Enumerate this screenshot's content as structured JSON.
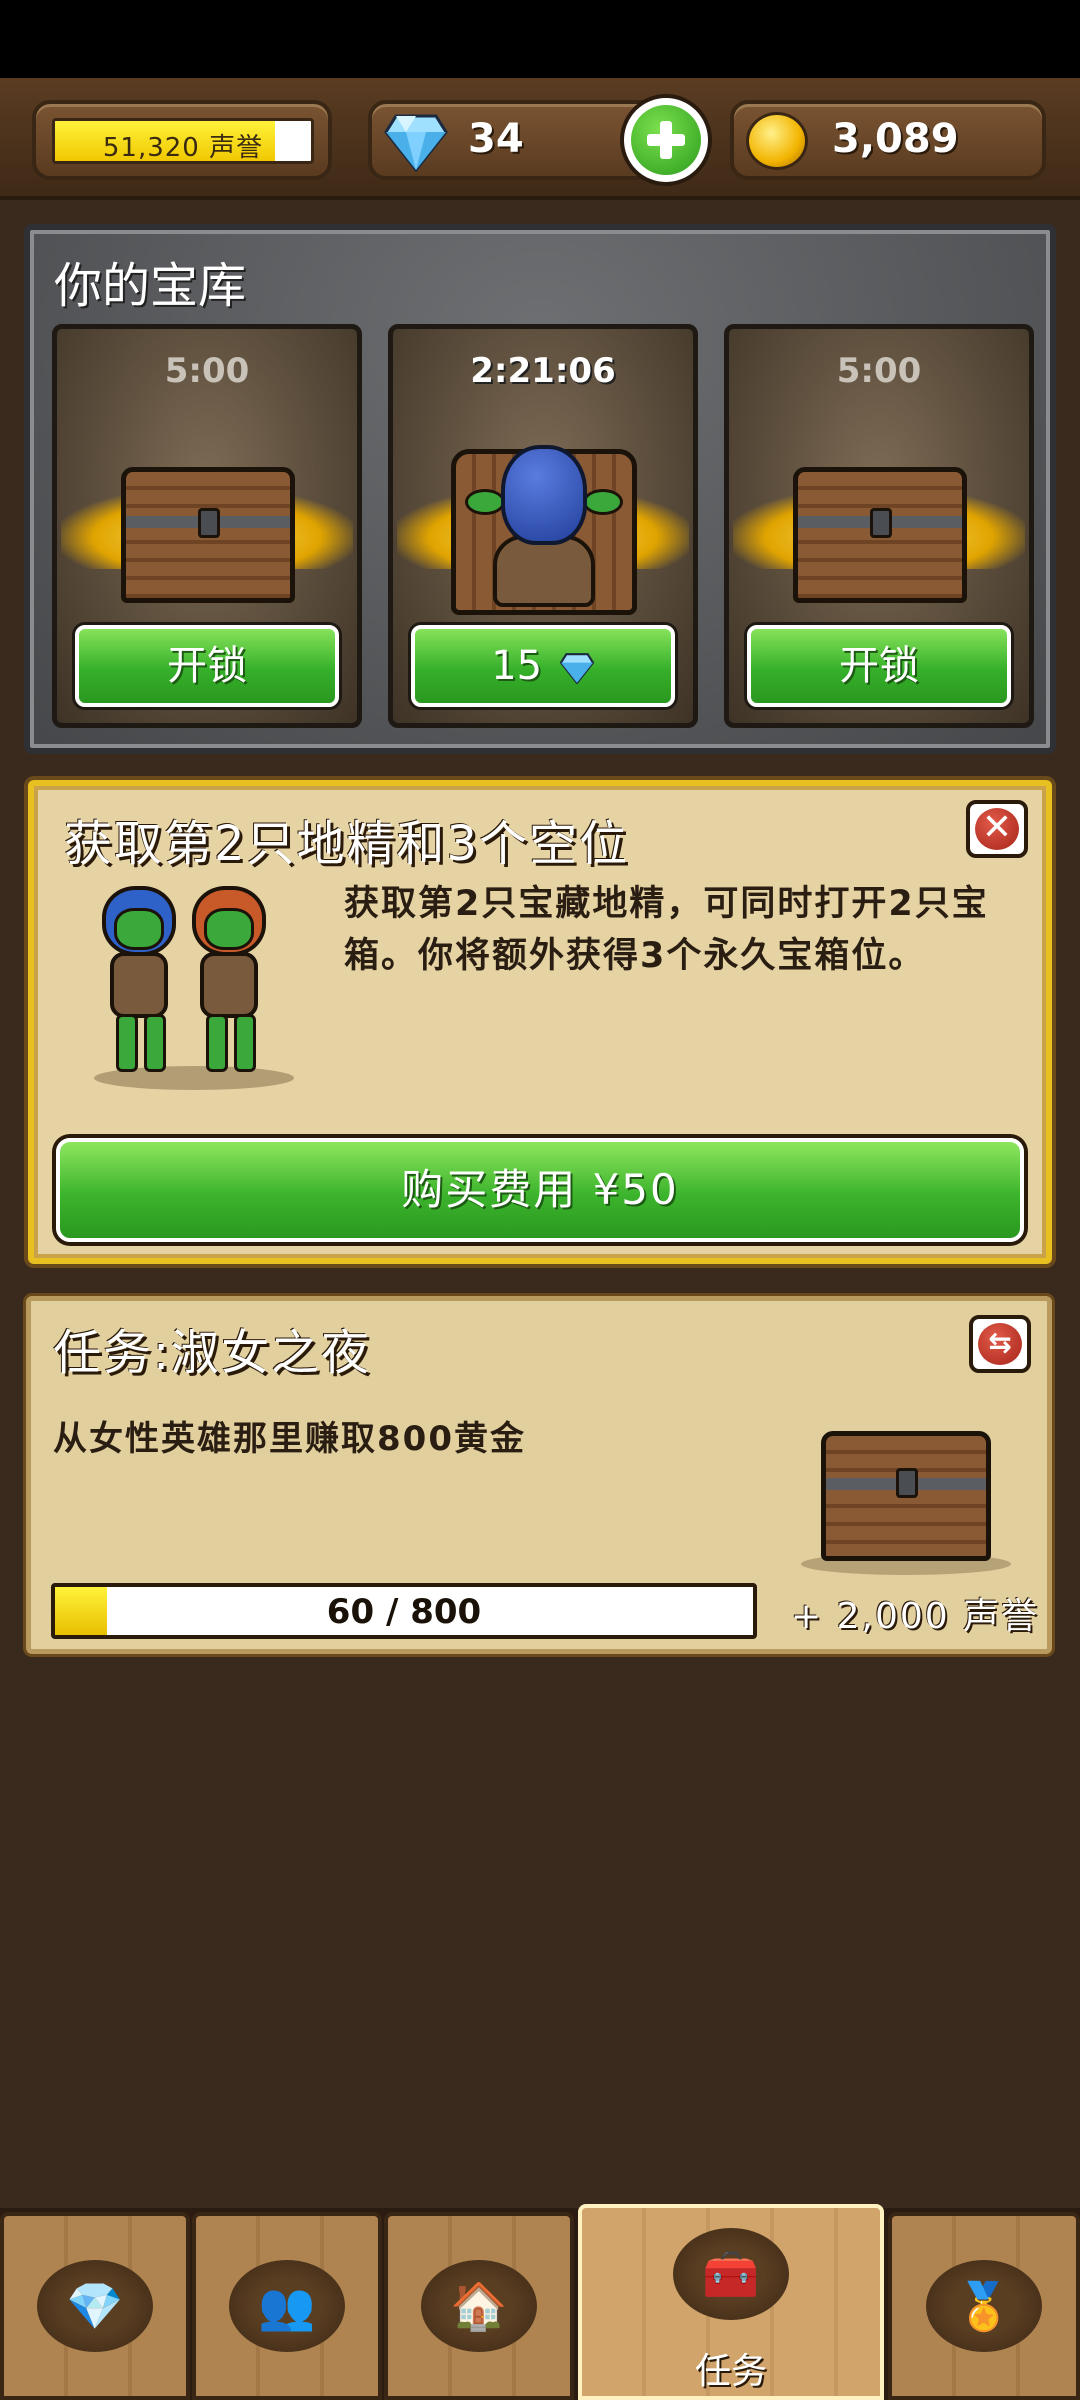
{
  "header": {
    "reputation": "51,320 声誉",
    "reputation_fill": 0.86,
    "gems": "34",
    "coins": "3,089"
  },
  "vault": {
    "title": "你的宝库",
    "slots": [
      {
        "timer": "5:00",
        "button": "开锁"
      },
      {
        "timer": "2:21:06",
        "button": "15"
      },
      {
        "timer": "5:00",
        "button": "开锁"
      }
    ]
  },
  "offer": {
    "title": "获取第2只地精和3个空位",
    "description": "获取第2只宝藏地精，可同时打开2只宝箱。你将额外获得3个永久宝箱位。",
    "buy_label": "购买费用 ¥50"
  },
  "quest": {
    "title": "任务:淑女之夜",
    "description": "从女性英雄那里赚取800黄金",
    "progress_text": "60 / 800",
    "progress_value": 60,
    "progress_max": 800,
    "reward": "+ 2,000 声誉"
  },
  "nav": {
    "items": [
      {
        "icon": "gem-icon",
        "glyph": "💎"
      },
      {
        "icon": "heroes-icon",
        "glyph": "👥"
      },
      {
        "icon": "town-icon",
        "glyph": "🏠"
      },
      {
        "icon": "treasure-chest-icon",
        "glyph": "🧰",
        "label": "任务"
      },
      {
        "icon": "medal-icon",
        "glyph": "🏅"
      }
    ]
  },
  "colors": {
    "green_button": "#36b02a",
    "gold_border": "#e8c020",
    "progress_yellow": "#fff23a"
  }
}
